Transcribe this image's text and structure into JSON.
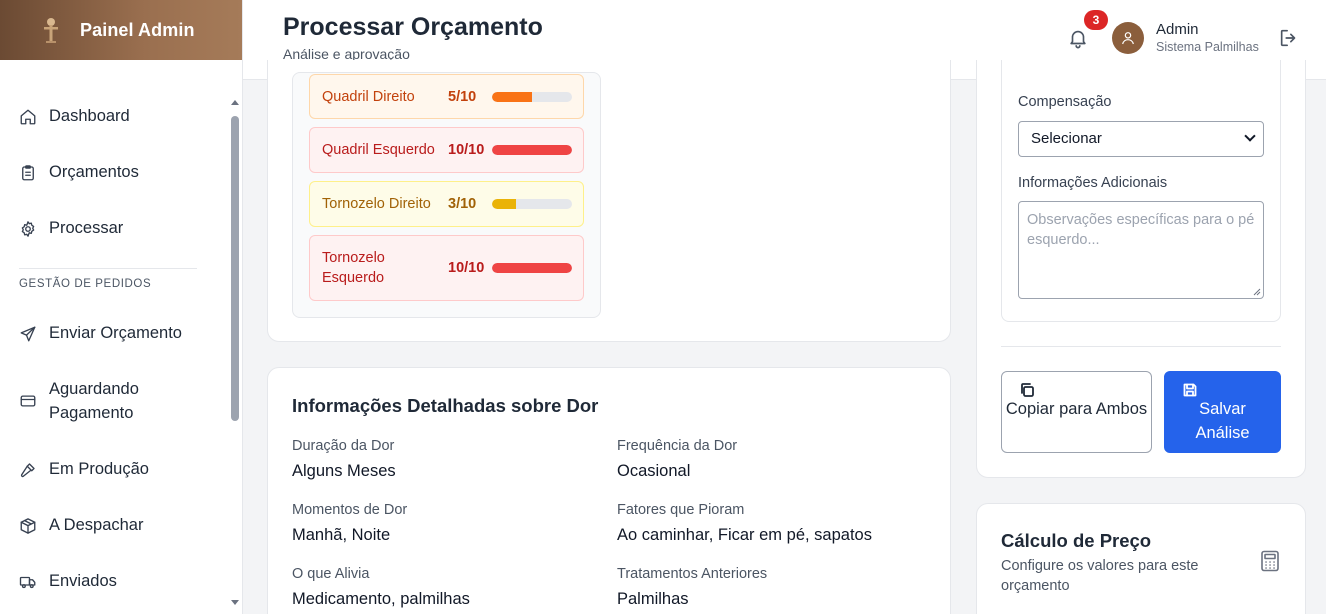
{
  "brand": {
    "title": "Painel Admin"
  },
  "sidebar": {
    "items": [
      {
        "label": "Dashboard",
        "icon": "home-icon"
      },
      {
        "label": "Orçamentos",
        "icon": "clipboard-icon"
      },
      {
        "label": "Processar",
        "icon": "gear-icon"
      }
    ],
    "section_title": "GESTÃO DE PEDIDOS",
    "orders": [
      {
        "label": "Enviar Orçamento",
        "icon": "send-icon"
      },
      {
        "label": "Aguardando Pagamento",
        "icon": "credit-card-icon"
      },
      {
        "label": "Em Produção",
        "icon": "hammer-icon"
      },
      {
        "label": "A Despachar",
        "icon": "package-icon"
      },
      {
        "label": "Enviados",
        "icon": "truck-icon"
      }
    ]
  },
  "header": {
    "title": "Processar Orçamento",
    "subtitle": "Análise e aprovação",
    "notifications": "3",
    "user_name": "Admin",
    "user_sub": "Sistema Palmilhas"
  },
  "pain_levels": [
    {
      "name": "Quadril Direito",
      "score": "5/10",
      "value": 5,
      "tone": "orange"
    },
    {
      "name": "Quadril Esquerdo",
      "score": "10/10",
      "value": 10,
      "tone": "red"
    },
    {
      "name": "Tornozelo Direito",
      "score": "3/10",
      "value": 3,
      "tone": "yellow"
    },
    {
      "name": "Tornozelo Esquerdo",
      "score": "10/10",
      "value": 10,
      "tone": "red"
    }
  ],
  "pain_info": {
    "title": "Informações Detalhadas sobre Dor",
    "fields": [
      {
        "label": "Duração da Dor",
        "value": "Alguns Meses"
      },
      {
        "label": "Frequência da Dor",
        "value": "Ocasional"
      },
      {
        "label": "Momentos de Dor",
        "value": "Manhã, Noite"
      },
      {
        "label": "Fatores que Pioram",
        "value": "Ao caminhar, Ficar em pé, sapatos"
      },
      {
        "label": "O que Alivia",
        "value": "Medicamento, palmilhas"
      },
      {
        "label": "Tratamentos Anteriores",
        "value": "Palmilhas"
      }
    ]
  },
  "analysis": {
    "compensation_label": "Compensação",
    "compensation_value": "Selecionar",
    "extra_label": "Informações Adicionais",
    "extra_placeholder": "Observações específicas para o pé esquerdo...",
    "copy_button": "Copiar para Ambos",
    "save_button": "Salvar Análise"
  },
  "price": {
    "title": "Cálculo de Preço",
    "subtitle": "Configure os valores para este orçamento"
  },
  "colors": {
    "primary": "#2563eb",
    "brand": "#8b5e3c",
    "badge": "#dc2626",
    "orange": "#f97316",
    "red": "#ef4444",
    "yellow": "#eab308"
  }
}
